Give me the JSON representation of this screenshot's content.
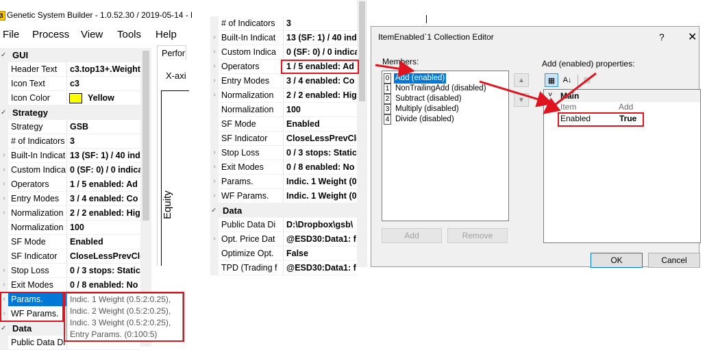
{
  "app": {
    "icon_letter": "3",
    "title": "Genetic System Builder - 1.0.52.30 / 2019-05-14 - l"
  },
  "menu": [
    "File",
    "Process",
    "View",
    "Tools",
    "Help"
  ],
  "left_grid": {
    "rows": [
      {
        "kind": "cat",
        "name": "GUI",
        "exp": "✓"
      },
      {
        "kind": "prop",
        "name": "Header Text",
        "value": "c3.top13+.Weight"
      },
      {
        "kind": "prop",
        "name": "Icon Text",
        "value": "c3"
      },
      {
        "kind": "prop",
        "name": "Icon Color",
        "value": "Yellow",
        "swatch": "#ffff00"
      },
      {
        "kind": "cat",
        "name": "Strategy",
        "exp": "✓"
      },
      {
        "kind": "prop",
        "name": "Strategy",
        "value": "GSB"
      },
      {
        "kind": "prop",
        "name": "# of Indicators",
        "value": "3"
      },
      {
        "kind": "prop",
        "name": "Built-In Indicat",
        "value": "13 (SF: 1) / 40 indi",
        "exp": "›"
      },
      {
        "kind": "prop",
        "name": "Custom Indica",
        "value": "0 (SF: 0) / 0 indica",
        "exp": "›"
      },
      {
        "kind": "prop",
        "name": "Operators",
        "value": "1 / 5 enabled: Ad",
        "exp": "›"
      },
      {
        "kind": "prop",
        "name": "Entry Modes",
        "value": "3 / 4 enabled: Co",
        "exp": "›"
      },
      {
        "kind": "prop",
        "name": "Normalization",
        "value": "2 / 2 enabled: Hig",
        "exp": "›"
      },
      {
        "kind": "prop",
        "name": "Normalization",
        "value": "100"
      },
      {
        "kind": "prop",
        "name": "SF Mode",
        "value": "Enabled"
      },
      {
        "kind": "prop",
        "name": "SF Indicator",
        "value": "CloseLessPrevClos"
      },
      {
        "kind": "prop",
        "name": "Stop Loss",
        "value": "0 / 3 stops: Static",
        "exp": "›"
      },
      {
        "kind": "prop",
        "name": "Exit Modes",
        "value": "0 / 8 enabled: No",
        "exp": "›"
      },
      {
        "kind": "prop",
        "name": "Params.",
        "value": "",
        "exp": "›",
        "selected": true
      },
      {
        "kind": "prop",
        "name": "WF Params.",
        "value": "",
        "exp": "›"
      },
      {
        "kind": "cat",
        "name": "Data",
        "exp": "✓"
      },
      {
        "kind": "prop",
        "name": "Public Data Di",
        "value": ""
      }
    ]
  },
  "perf_tab": "Perfor",
  "chart": {
    "xaxis": "X-axi",
    "ylabel": "Equity"
  },
  "tooltip": [
    "Indic. 1 Weight (0.5:2:0.25),",
    "Indic. 2 Weight (0.5:2:0.25),",
    "Indic. 3 Weight (0.5:2:0.25),",
    "Entry Params. (0:100:5)"
  ],
  "mid_grid": {
    "rows": [
      {
        "kind": "prop",
        "name": "# of Indicators",
        "value": "3"
      },
      {
        "kind": "prop",
        "name": "Built-In Indicat",
        "value": "13 (SF: 1) / 40 indi",
        "exp": "›"
      },
      {
        "kind": "prop",
        "name": "Custom Indica",
        "value": "0 (SF: 0) / 0 indica",
        "exp": "›"
      },
      {
        "kind": "prop",
        "name": "Operators",
        "value": "1 / 5 enabled: Ad",
        "exp": "›",
        "selected": true
      },
      {
        "kind": "prop",
        "name": "Entry Modes",
        "value": "3 / 4 enabled: Co",
        "exp": "›"
      },
      {
        "kind": "prop",
        "name": "Normalization",
        "value": "2 / 2 enabled: Hig",
        "exp": "›"
      },
      {
        "kind": "prop",
        "name": "Normalization",
        "value": "100"
      },
      {
        "kind": "prop",
        "name": "SF Mode",
        "value": "Enabled"
      },
      {
        "kind": "prop",
        "name": "SF Indicator",
        "value": "CloseLessPrevClos"
      },
      {
        "kind": "prop",
        "name": "Stop Loss",
        "value": "0 / 3 stops: Static",
        "exp": "›"
      },
      {
        "kind": "prop",
        "name": "Exit Modes",
        "value": "0 / 8 enabled: No",
        "exp": "›"
      },
      {
        "kind": "prop",
        "name": "Params.",
        "value": "Indic. 1 Weight (0",
        "exp": "›"
      },
      {
        "kind": "prop",
        "name": "WF Params.",
        "value": "Indic. 1 Weight (0",
        "exp": "›"
      },
      {
        "kind": "cat",
        "name": "Data",
        "exp": "✓"
      },
      {
        "kind": "prop",
        "name": "Public Data Di",
        "value": "D:\\Dropbox\\gsb\\"
      },
      {
        "kind": "prop",
        "name": "Opt. Price Dat",
        "value": "@ESD30:Data1: f",
        "exp": "›"
      },
      {
        "kind": "prop",
        "name": "Optimize Opt.",
        "value": "False"
      },
      {
        "kind": "prop",
        "name": "TPD (Trading f",
        "value": "@ESD30:Data1: f"
      }
    ]
  },
  "dialog": {
    "title": "ItemEnabled`1 Collection Editor",
    "help": "?",
    "close": "✕",
    "members_label": "Members:",
    "members": [
      {
        "index": "0",
        "label": "Add (enabled)",
        "selected": true
      },
      {
        "index": "1",
        "label": "NonTrailingAdd (disabled)"
      },
      {
        "index": "2",
        "label": "Subtract (disabled)"
      },
      {
        "index": "3",
        "label": "Multiply (disabled)"
      },
      {
        "index": "4",
        "label": "Divide (disabled)"
      }
    ],
    "up_arrow": "▲",
    "down_arrow": "▼",
    "add_button": "Add",
    "remove_button": "Remove",
    "props_label": "Add (enabled) properties:",
    "props_category": "Main",
    "props_header_item": "Item",
    "props_header_value": "Add",
    "prop_name": "Enabled",
    "prop_value": "True",
    "ok_button": "OK",
    "cancel_button": "Cancel",
    "tb_categorized": "▦",
    "tb_alpha": "A↓",
    "tb_pages": "▤"
  },
  "colors": {
    "selection": "#0078d7",
    "annotation": "#e0141e"
  }
}
